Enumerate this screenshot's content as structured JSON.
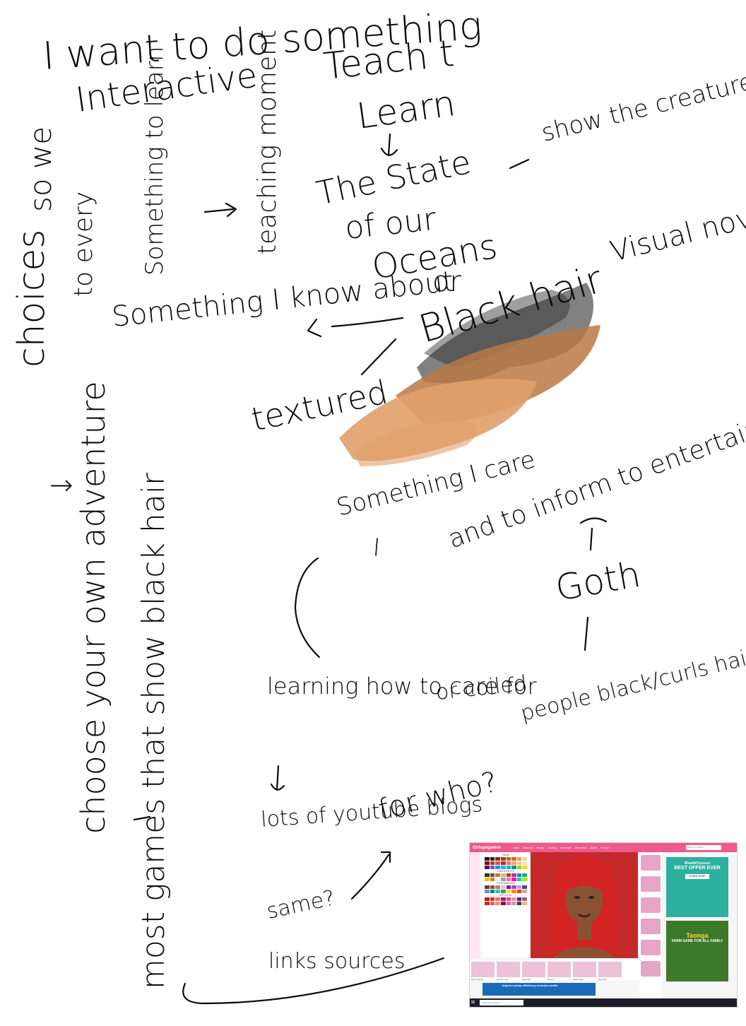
{
  "notes": {
    "n1": "I want to do something",
    "n2": "Interactive",
    "n3": "Teach t",
    "n4": "Learn",
    "n5": "choices",
    "n6": "so we",
    "n7": "to every",
    "n8": "Something to learn",
    "n9": "teaching moment",
    "n10": "The State",
    "n11": "of our",
    "n12": "Oceans",
    "n13": "or",
    "n14": "show the creatures of the sea?",
    "n15": "Black hair",
    "n16": "Visual novel? not for me",
    "n17": "Something I know about",
    "n18": "textured",
    "n19": "Something I care",
    "n20": "and to inform to entertain",
    "n21": "Goth",
    "n22": "choose your own adventure",
    "n23": "most games that show black hair",
    "n24": "learning how to care for",
    "n25": "or coiled",
    "n26": "lots of youtube blogs",
    "n27": "same?",
    "n28": "links sources",
    "n29": "for who?",
    "n30": "people black/curls hair or those without"
  },
  "screenshot": {
    "site_logo": "Girlsgogames",
    "nav": [
      "Apps",
      "Dress Up",
      "Beauty",
      "Cooking",
      "Makeover",
      "Decoration",
      "Movie",
      "For you"
    ],
    "search_placeholder": "Search for Games",
    "palette_sections": [
      "HAIR",
      "HIGHLIGHTS",
      "EYESHADOW",
      "LIPSTICK"
    ],
    "ad1_brand": "WealthCounsel",
    "ad1_headline": "BEST OFFER EVER",
    "ad1_button": "LEARN MORE",
    "ad2_brand": "Taonga",
    "ad2_sub": "FARM GAME FOR ALL FAMILY",
    "strip_items": [
      "Back To School",
      "My Prom Look",
      "Dreamygirl",
      "Fantasy",
      "Fashion Blog",
      "Show Hair"
    ],
    "banner_text": "Improve pump efficiency, increase profits",
    "taskbar_search": "Type here to search",
    "colors": {
      "brand_pink": "#ee5a8e",
      "hair_red": "#d22323",
      "ad_teal": "#2eb0a0",
      "ad_green": "#3c7a2a"
    }
  },
  "brush": {
    "black": "#1a1a1a",
    "brown": "#b87945",
    "tan": "#e0a06a"
  }
}
